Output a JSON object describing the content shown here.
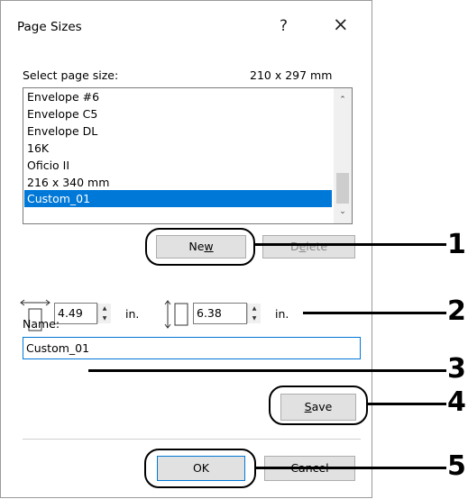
{
  "dialog": {
    "title": "Page Sizes",
    "help_glyph": "?",
    "close_glyph": "×",
    "select_label": "Select page size:",
    "size_display": "210 x 297 mm",
    "list_items": [
      "Envelope #6",
      "Envelope C5",
      "Envelope DL",
      "16K",
      "Oficio II",
      "216 x 340 mm",
      "Custom_01"
    ],
    "selected_item": "Custom_01",
    "scroll_up": "⌃",
    "scroll_down": "⌄",
    "new_label_pre": "Ne",
    "new_label_u": "w",
    "delete_label_pre": "D",
    "delete_label_u": "e",
    "delete_label_post": "lete",
    "width_value": "4.49",
    "height_value": "6.38",
    "unit": "in.",
    "spin_up": "▲",
    "spin_down": "▼",
    "name_label": "Name:",
    "name_value": "Custom_01",
    "save_label_u": "S",
    "save_label_post": "ave",
    "ok_label": "OK",
    "cancel_label": "Cancel"
  },
  "callouts": [
    "1",
    "2",
    "3",
    "4",
    "5"
  ],
  "colors": {
    "selection": "#0078d7",
    "button_face": "#e1e1e1",
    "callout": "#000000"
  }
}
